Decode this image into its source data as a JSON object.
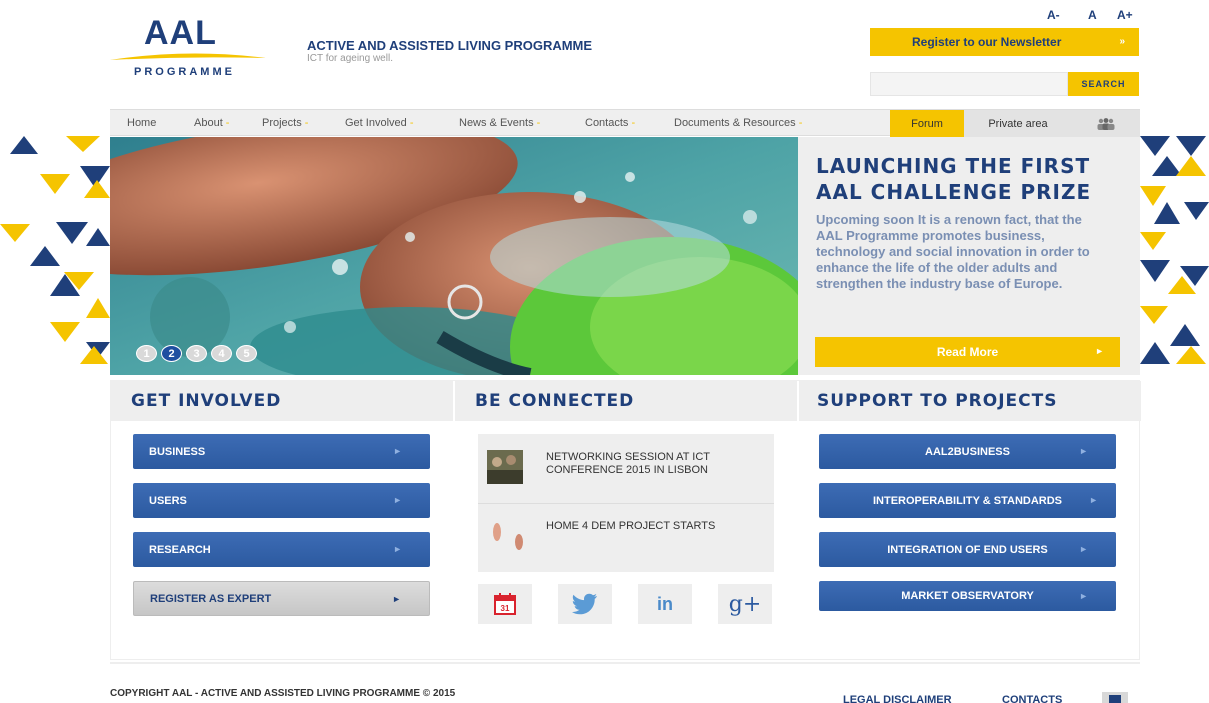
{
  "header": {
    "logo_text": "AAL",
    "logo_sub": "PROGRAMME",
    "site_title": "ACTIVE AND ASSISTED LIVING PROGRAMME",
    "tagline": "ICT for ageing well.",
    "font_sizes": [
      "A-",
      "A",
      "A+"
    ],
    "newsletter_label": "Register to our Newsletter",
    "newsletter_arrow": "»",
    "search_placeholder": "",
    "search_label": "SEARCH"
  },
  "nav": {
    "items": [
      "Home",
      "About",
      "Projects",
      "Get Involved",
      "News & Events",
      "Contacts",
      "Documents & Resources"
    ],
    "forum": "Forum",
    "private": "Private area",
    "users_icon": "users-icon"
  },
  "hero": {
    "title": "LAUNCHING THE FIRST AAL CHALLENGE PRIZE",
    "text": "Upcoming soon  It is a renown fact, that the AAL Programme promotes business, technology and social innovation in order to enhance the life of the older adults and strengthen the industry base of Europe.",
    "read_more": "Read More",
    "read_more_arrow": "►",
    "slides": [
      "1",
      "2",
      "3",
      "4",
      "5"
    ],
    "active_slide": 2
  },
  "get_involved": {
    "heading": "GET INVOLVED",
    "buttons": [
      "BUSINESS",
      "USERS",
      "RESEARCH"
    ],
    "expert": "REGISTER AS EXPERT",
    "arrow": "►"
  },
  "be_connected": {
    "heading": "BE CONNECTED",
    "news": [
      {
        "title": "NETWORKING SESSION AT ICT CONFERENCE 2015 IN LISBON"
      },
      {
        "title": "HOME 4 DEM PROJECT STARTS"
      }
    ],
    "calendar_day": "31",
    "linkedin": "in",
    "gplus": "g+"
  },
  "support": {
    "heading": "SUPPORT TO PROJECTS",
    "buttons": [
      "AAL2BUSINESS",
      "INTEROPERABILITY & STANDARDS",
      "INTEGRATION OF END USERS",
      "MARKET OBSERVATORY"
    ]
  },
  "footer": {
    "copyright": "COPYRIGHT AAL - ACTIVE AND ASSISTED LIVING PROGRAMME © 2015",
    "legal": "LEGAL DISCLAIMER",
    "contacts": "CONTACTS"
  },
  "colors": {
    "brand_blue": "#1f3f7a",
    "accent_yellow": "#f5c400",
    "button_blue": "#2c5aa0"
  }
}
